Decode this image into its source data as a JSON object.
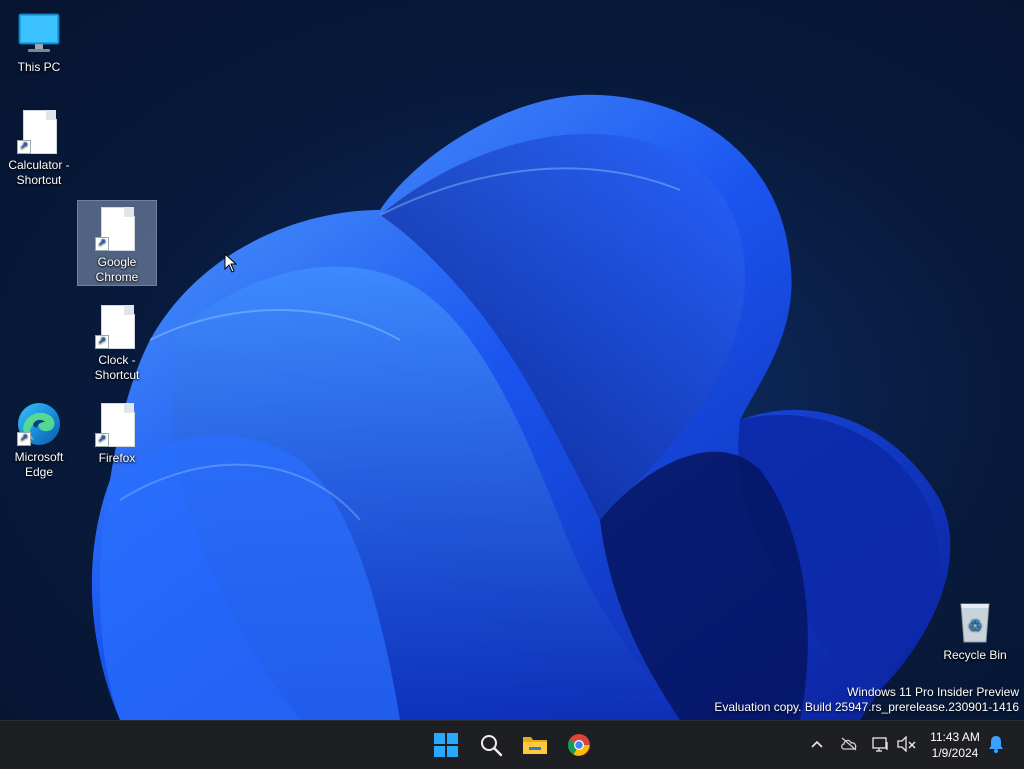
{
  "desktop": {
    "icons": [
      {
        "label": "This PC",
        "type": "computer",
        "selected": false
      },
      {
        "label": "Calculator - Shortcut",
        "type": "shortcut",
        "selected": false
      },
      {
        "label": "Google Chrome",
        "type": "shortcut",
        "selected": true
      },
      {
        "label": "Clock - Shortcut",
        "type": "shortcut",
        "selected": false
      },
      {
        "label": "Microsoft Edge",
        "type": "edge",
        "selected": false
      },
      {
        "label": "Firefox",
        "type": "shortcut",
        "selected": false
      },
      {
        "label": "Recycle Bin",
        "type": "recycle-bin",
        "selected": false
      }
    ],
    "watermark": {
      "line1": "Windows 11 Pro Insider Preview",
      "line2": "Evaluation copy. Build 25947.rs_prerelease.230901-1416"
    }
  },
  "taskbar": {
    "pinned": [
      {
        "name": "Start",
        "icon": "windows-logo-icon"
      },
      {
        "name": "Search",
        "icon": "search-icon"
      },
      {
        "name": "File Explorer",
        "icon": "folder-icon"
      },
      {
        "name": "Google Chrome",
        "icon": "chrome-icon"
      }
    ],
    "tray": {
      "icons": [
        "chevron-up-icon",
        "onedrive-offline-icon",
        "network-icon",
        "volume-muted-icon"
      ],
      "time": "11:43 AM",
      "date": "1/9/2024",
      "notification_icon": "bell-icon"
    }
  },
  "colors": {
    "taskbar_bg": "#1e1f23",
    "accent_blue": "#1f6bff",
    "windows_logo": "#29a8ff"
  }
}
